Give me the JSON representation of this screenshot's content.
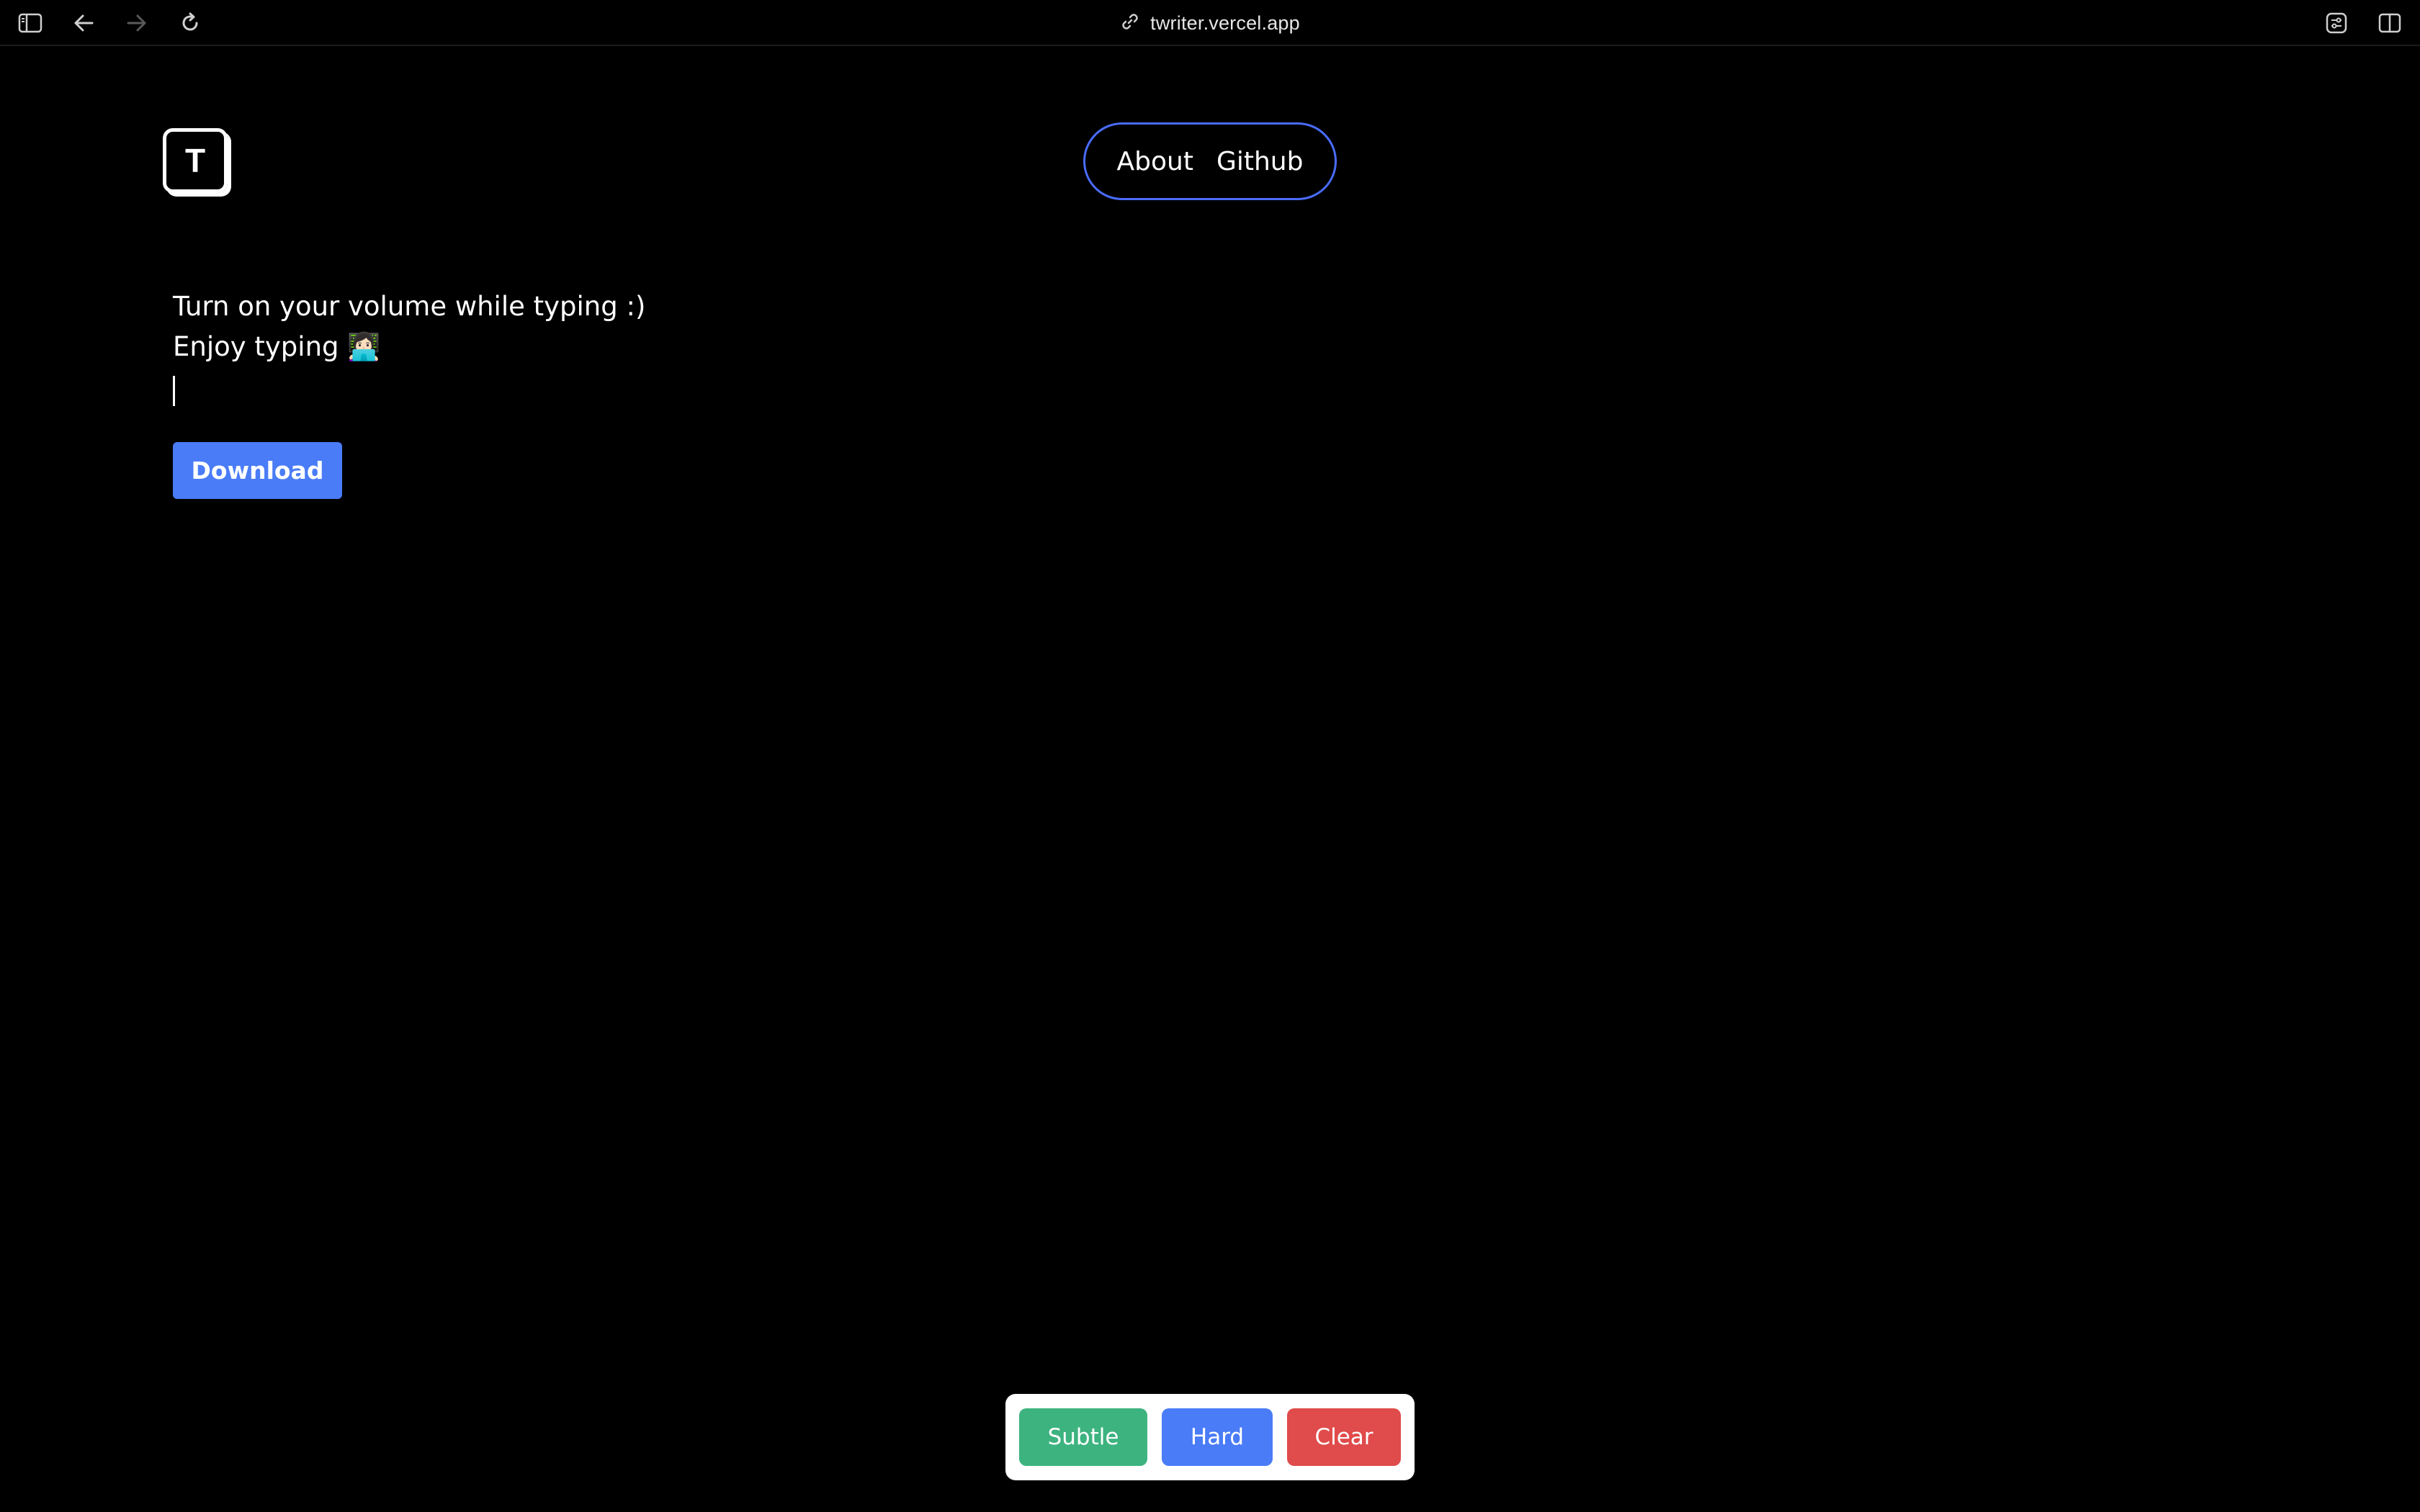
{
  "browser": {
    "url": "twriter.vercel.app",
    "icons": {
      "sidebar": "sidebar-toggle-icon",
      "back": "back-arrow-icon",
      "forward": "forward-arrow-icon",
      "reload": "reload-icon",
      "link": "link-icon",
      "extensions": "extensions-icon",
      "split_view": "split-view-icon"
    }
  },
  "header": {
    "logo_letter": "T",
    "nav": {
      "about": "About",
      "github": "Github"
    }
  },
  "editor": {
    "lines": [
      "Turn on your volume while typing :)",
      "Enjoy typing 👩🏻‍💻"
    ],
    "download_label": "Download"
  },
  "controls": {
    "subtle": "Subtle",
    "hard": "Hard",
    "clear": "Clear"
  },
  "colors": {
    "background": "#000000",
    "accent_blue": "#4a7cf7",
    "nav_border": "#4a6cff",
    "subtle_green": "#3db37f",
    "clear_red": "#e04b4b"
  }
}
